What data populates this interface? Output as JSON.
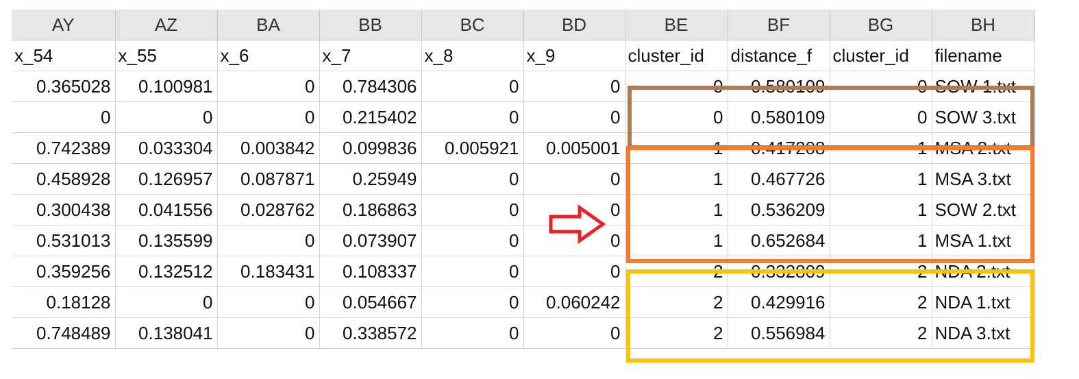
{
  "columns": [
    "AY",
    "AZ",
    "BA",
    "BB",
    "BC",
    "BD",
    "BE",
    "BF",
    "BG",
    "BH"
  ],
  "field_names": [
    "x_54",
    "x_55",
    "x_6",
    "x_7",
    "x_8",
    "x_9",
    "cluster_id",
    "distance_f",
    "cluster_id",
    "filename"
  ],
  "rows": [
    [
      "0.365028",
      "0.100981",
      "0",
      "0.784306",
      "0",
      "0",
      "0",
      "0.580109",
      "0",
      "SOW 1.txt"
    ],
    [
      "0",
      "0",
      "0",
      "0.215402",
      "0",
      "0",
      "0",
      "0.580109",
      "0",
      "SOW 3.txt"
    ],
    [
      "0.742389",
      "0.033304",
      "0.003842",
      "0.099836",
      "0.005921",
      "0.005001",
      "1",
      "0.417208",
      "1",
      "MSA 2.txt"
    ],
    [
      "0.458928",
      "0.126957",
      "0.087871",
      "0.25949",
      "0",
      "0",
      "1",
      "0.467726",
      "1",
      "MSA 3.txt"
    ],
    [
      "0.300438",
      "0.041556",
      "0.028762",
      "0.186863",
      "0",
      "0",
      "1",
      "0.536209",
      "1",
      "SOW 2.txt"
    ],
    [
      "0.531013",
      "0.135599",
      "0",
      "0.073907",
      "0",
      "0",
      "1",
      "0.652684",
      "1",
      "MSA 1.txt"
    ],
    [
      "0.359256",
      "0.132512",
      "0.183431",
      "0.108337",
      "0",
      "0",
      "2",
      "0.332809",
      "2",
      "NDA 2.txt"
    ],
    [
      "0.18128",
      "0",
      "0",
      "0.054667",
      "0",
      "0.060242",
      "2",
      "0.429916",
      "2",
      "NDA 1.txt"
    ],
    [
      "0.748489",
      "0.138041",
      "0",
      "0.338572",
      "0",
      "0",
      "2",
      "0.556984",
      "2",
      "NDA 3.txt"
    ]
  ],
  "annotations": {
    "cluster_box_colors": [
      "#b07a56",
      "#f47c2c",
      "#fbc20c"
    ],
    "arrow_color": "#e8232a",
    "arrow_icon": "right-arrow-icon"
  }
}
